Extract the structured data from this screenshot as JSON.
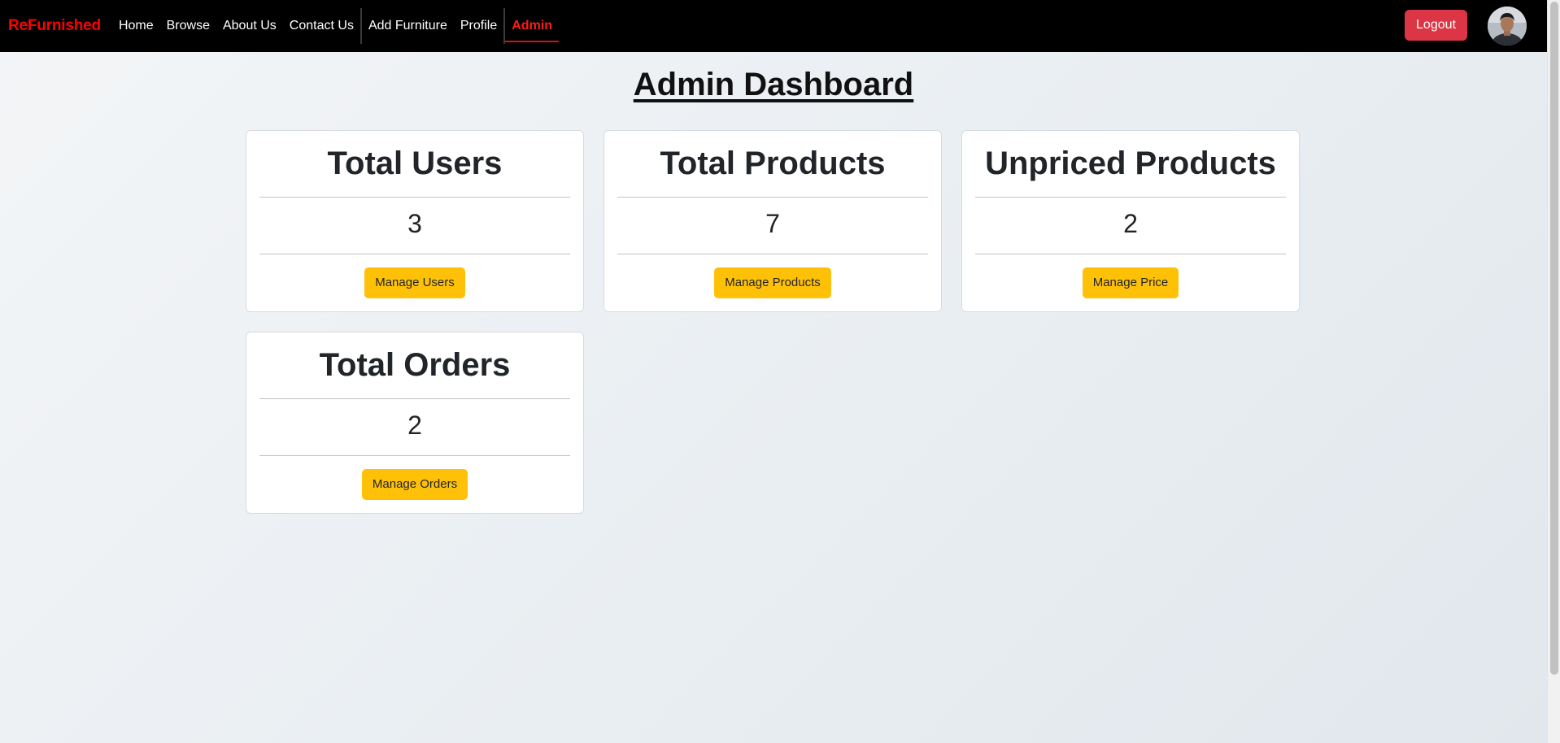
{
  "navbar": {
    "brand": "ReFurnished",
    "links": [
      {
        "label": "Home"
      },
      {
        "label": "Browse"
      },
      {
        "label": "About Us"
      },
      {
        "label": "Contact Us"
      },
      {
        "label": "Add Furniture"
      },
      {
        "label": "Profile"
      },
      {
        "label": "Admin"
      }
    ],
    "active": "Admin",
    "logout_label": "Logout"
  },
  "page": {
    "title": "Admin Dashboard"
  },
  "cards": [
    {
      "title": "Total Users",
      "value": "3",
      "button": "Manage Users"
    },
    {
      "title": "Total Products",
      "value": "7",
      "button": "Manage Products"
    },
    {
      "title": "Unpriced Products",
      "value": "2",
      "button": "Manage Price"
    },
    {
      "title": "Total Orders",
      "value": "2",
      "button": "Manage Orders"
    }
  ],
  "colors": {
    "navbar_bg": "#000000",
    "brand": "#ff0000",
    "active_link": "#ff1a1a",
    "logout_bg": "#dc3545",
    "action_button_bg": "#ffc107"
  }
}
